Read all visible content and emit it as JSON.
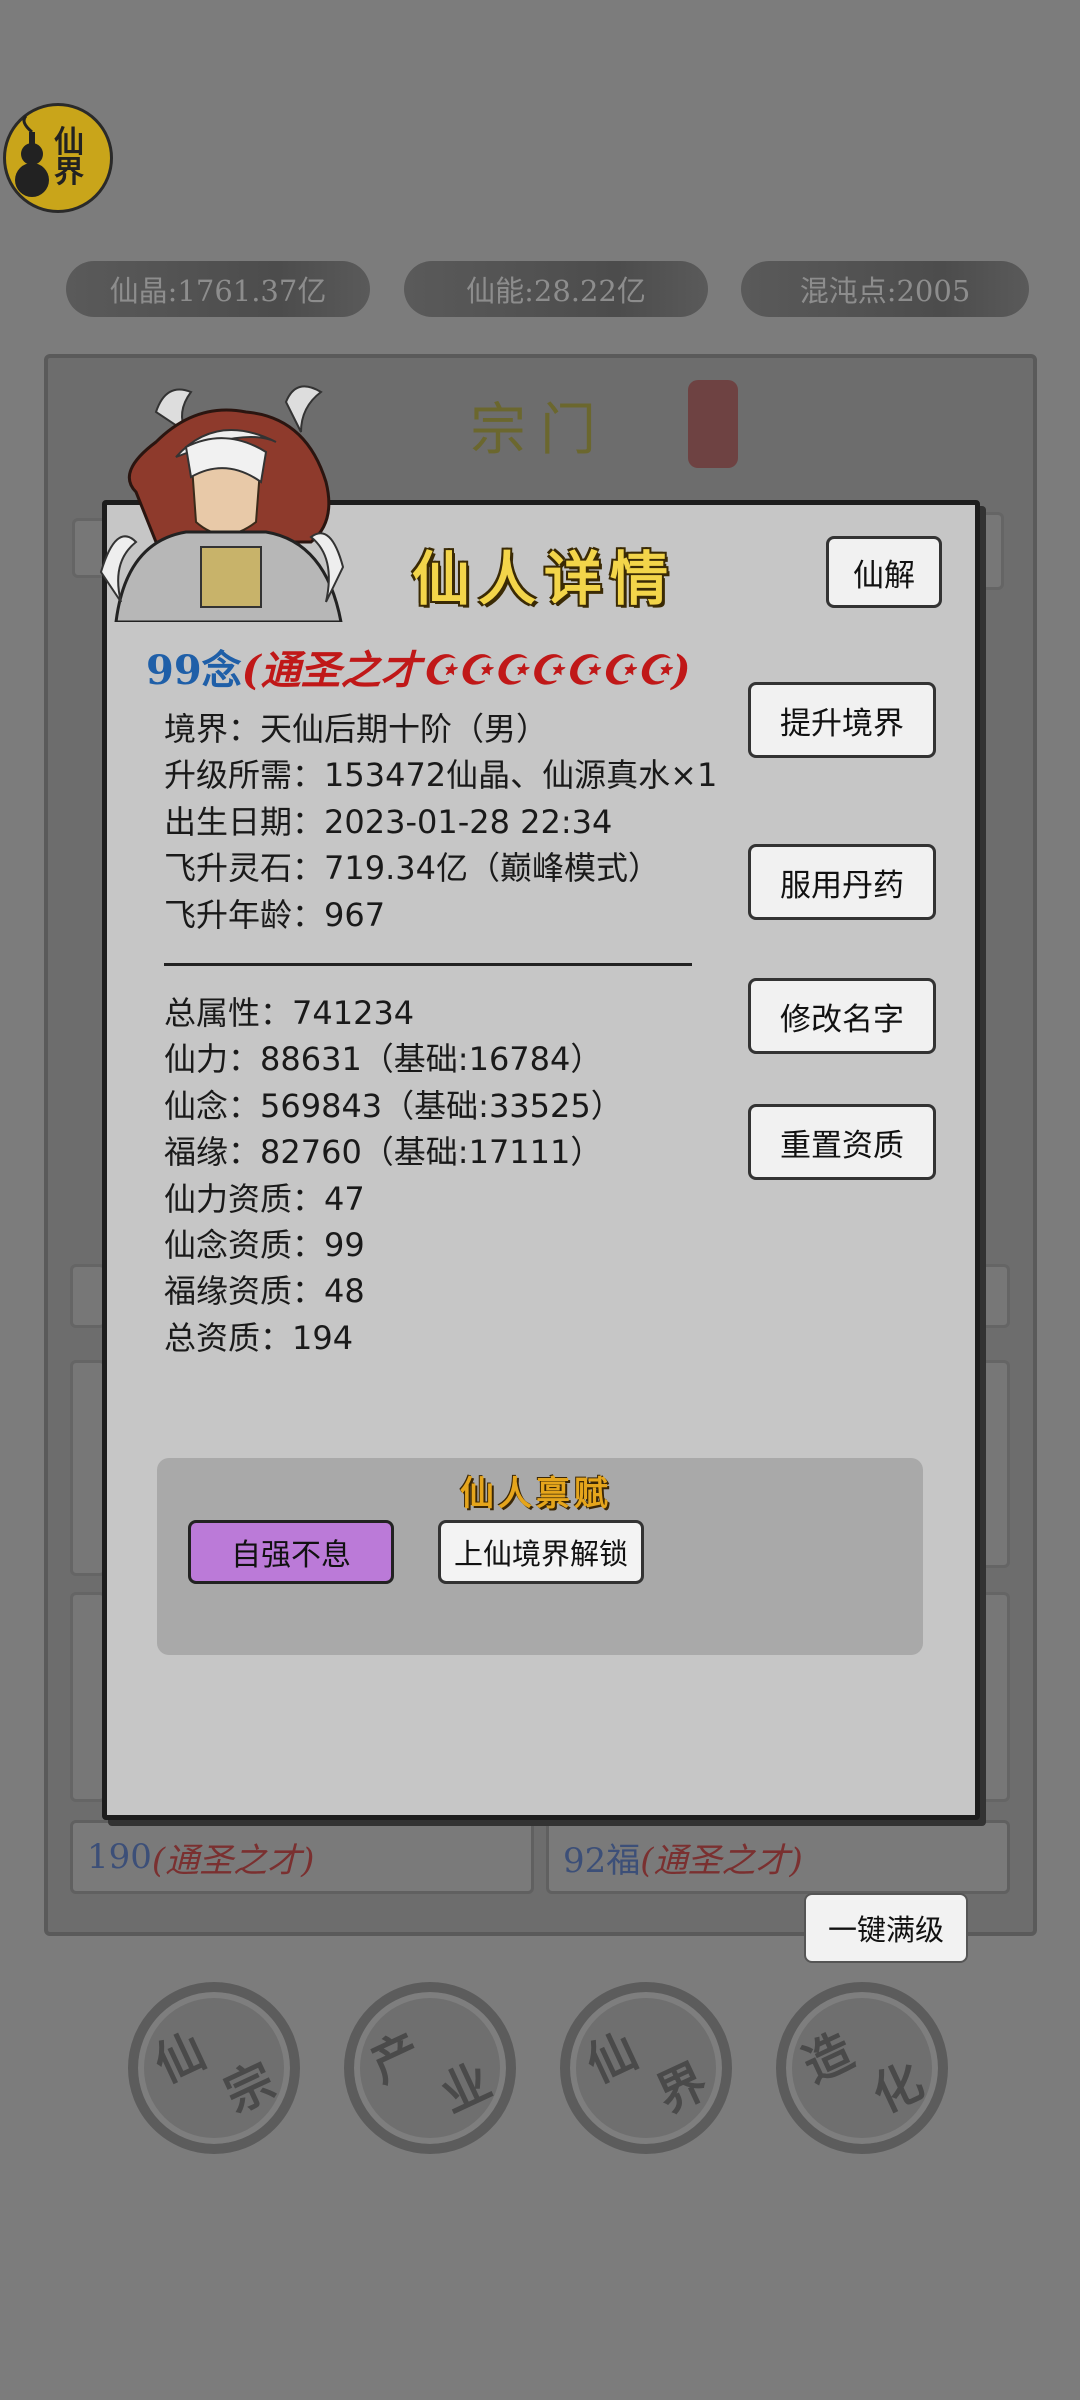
{
  "realm_badge": {
    "label": "仙界",
    "icon": "calabash-icon"
  },
  "resources": [
    {
      "label": "仙晶:1761.37亿"
    },
    {
      "label": "仙能:28.22亿"
    },
    {
      "label": "混沌点:2005"
    }
  ],
  "section": {
    "title": "宗门"
  },
  "background_cards": [
    {
      "num": "190",
      "aptitude": "(通圣之才)"
    },
    {
      "num": "92福",
      "aptitude": "(通圣之才)"
    }
  ],
  "one_key_button": "一键满级",
  "bottom_nav": [
    {
      "c1": "仙",
      "c2": "宗"
    },
    {
      "c1": "产",
      "c2": "业"
    },
    {
      "c1": "仙",
      "c2": "界"
    },
    {
      "c1": "造",
      "c2": "化"
    }
  ],
  "modal": {
    "title": "仙人详情",
    "dismiss_button": "仙解",
    "heading": {
      "num": "99念",
      "aptitude": "(通圣之才☪☪☪☪☪☪☪)"
    },
    "info_rows": [
      "境界：天仙后期十阶（男）",
      "升级所需：153472仙晶、仙源真水×1",
      "出生日期：2023-01-28 22:34",
      "飞升灵石：719.34亿（巅峰模式）",
      "飞升年龄：967"
    ],
    "attr_rows": [
      "总属性：741234",
      "仙力：88631（基础:16784）",
      "仙念：569843（基础:33525）",
      "福缘：82760（基础:17111）",
      "仙力资质：47",
      "仙念资质：99",
      "福缘资质：48",
      "总资质：194"
    ],
    "actions": {
      "upgrade": "提升境界",
      "pill": "服用丹药",
      "rename": "修改名字",
      "reset": "重置资质"
    },
    "talent": {
      "title": "仙人禀赋",
      "active": "自强不息",
      "locked": "上仙境界解锁"
    }
  },
  "colors": {
    "modal_bg": "#c6c6c6",
    "title_gold": "#f3d54a",
    "talent_purple": "#bb7ad8",
    "aptitude_red": "#c01818",
    "number_blue": "#1f5fa8"
  }
}
